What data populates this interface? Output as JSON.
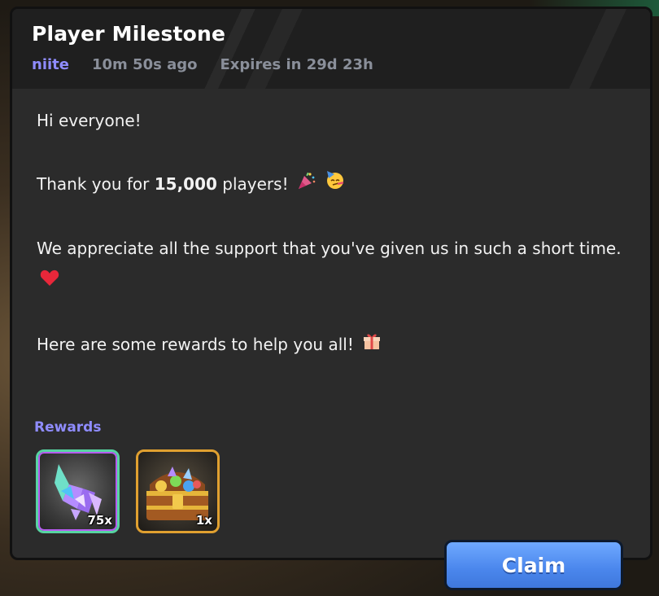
{
  "dialog": {
    "title": "Player Milestone",
    "author": "niite",
    "posted_ago": "10m 50s ago",
    "expires": "Expires in 29d 23h"
  },
  "message": {
    "line1": "Hi everyone!",
    "line2_pre": "Thank you for ",
    "line2_bold": "15,000",
    "line2_post": " players!",
    "line3": "We appreciate all the support that you've given us in such a short time.",
    "line4": "Here are some rewards to help you all!"
  },
  "rewards": {
    "label": "Rewards",
    "items": [
      {
        "name": "crystal-shards",
        "quantity": "75x"
      },
      {
        "name": "treasure-chest",
        "quantity": "1x"
      }
    ]
  },
  "claim_label": "Claim",
  "colors": {
    "accent": "#8f8cff",
    "claim_button": "#4a86ec",
    "panel": "#2b2b2b"
  }
}
